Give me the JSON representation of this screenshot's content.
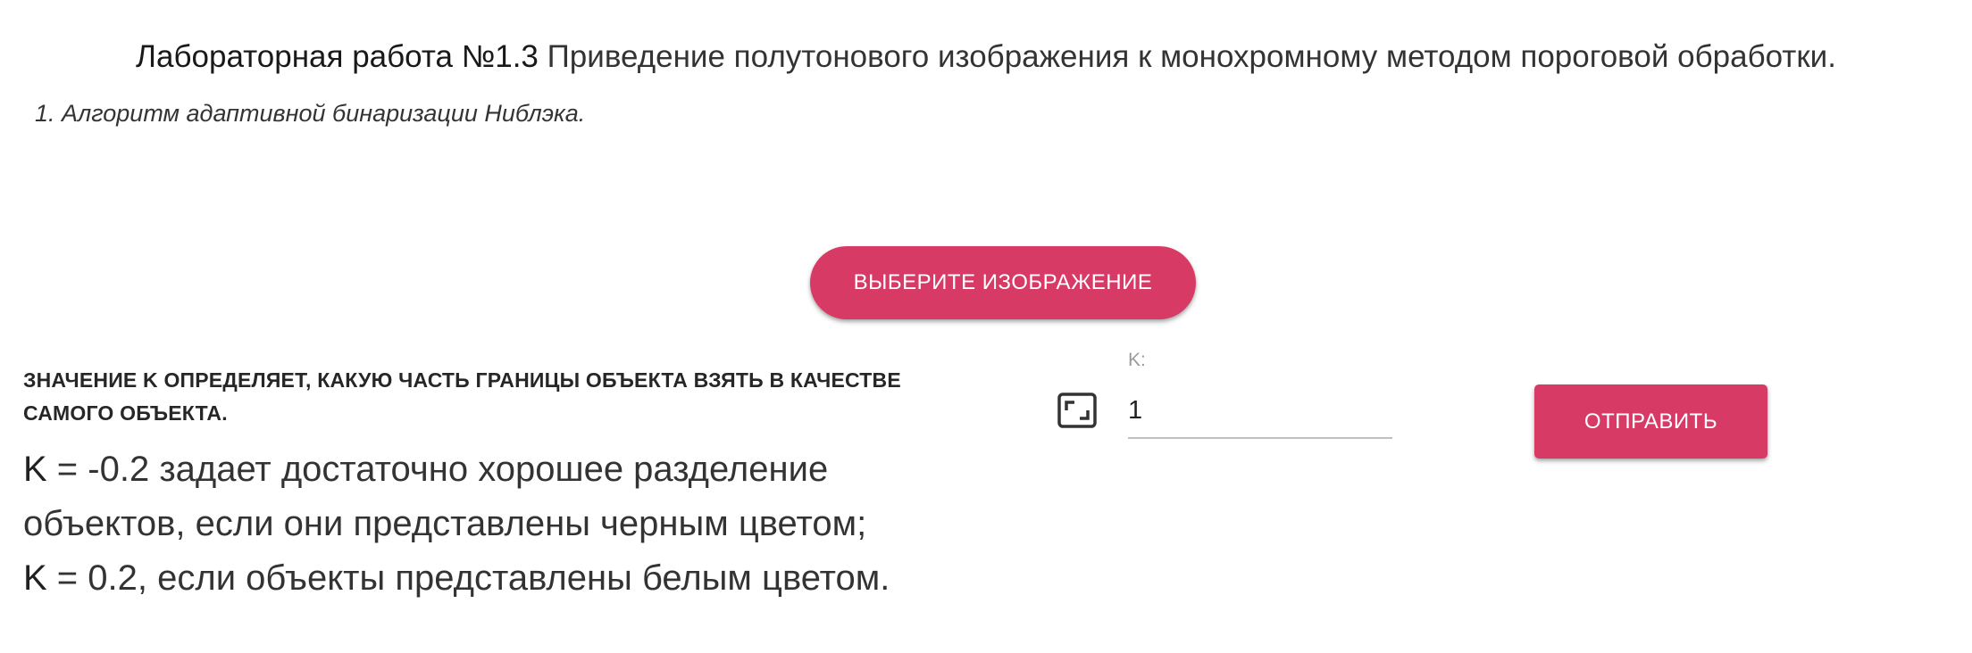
{
  "header": {
    "title_bold": "Лабораторная работа №1.3",
    "title_rest": "Приведение полутонового изображения к монохромному методом пороговой обработки.",
    "subtitle": "1. Алгоритм адаптивной бинаризации Ниблэка."
  },
  "upload": {
    "choose_label": "ВЫБЕРИТЕ ИЗОБРАЖЕНИЕ"
  },
  "description": {
    "heading": "ЗНАЧЕНИЕ K ОПРЕДЕЛЯЕТ, КАКУЮ ЧАСТЬ ГРАНИЦЫ ОБЪЕКТА ВЗЯТЬ В КАЧЕСТВЕ САМОГО ОБЪЕКТА.",
    "line1_k": "K",
    "line1_rest": " = -0.2 задает достаточно хорошее разделение объектов, если они представлены черным цветом;",
    "line2_k": "K",
    "line2_rest": " = 0.2, если объекты представлены белым цветом."
  },
  "form": {
    "k_label": "K:",
    "k_value": "1",
    "icon": "aspect-ratio-icon",
    "submit_label": "ОТПРАВИТЬ"
  },
  "colors": {
    "accent": "#d83a66"
  }
}
